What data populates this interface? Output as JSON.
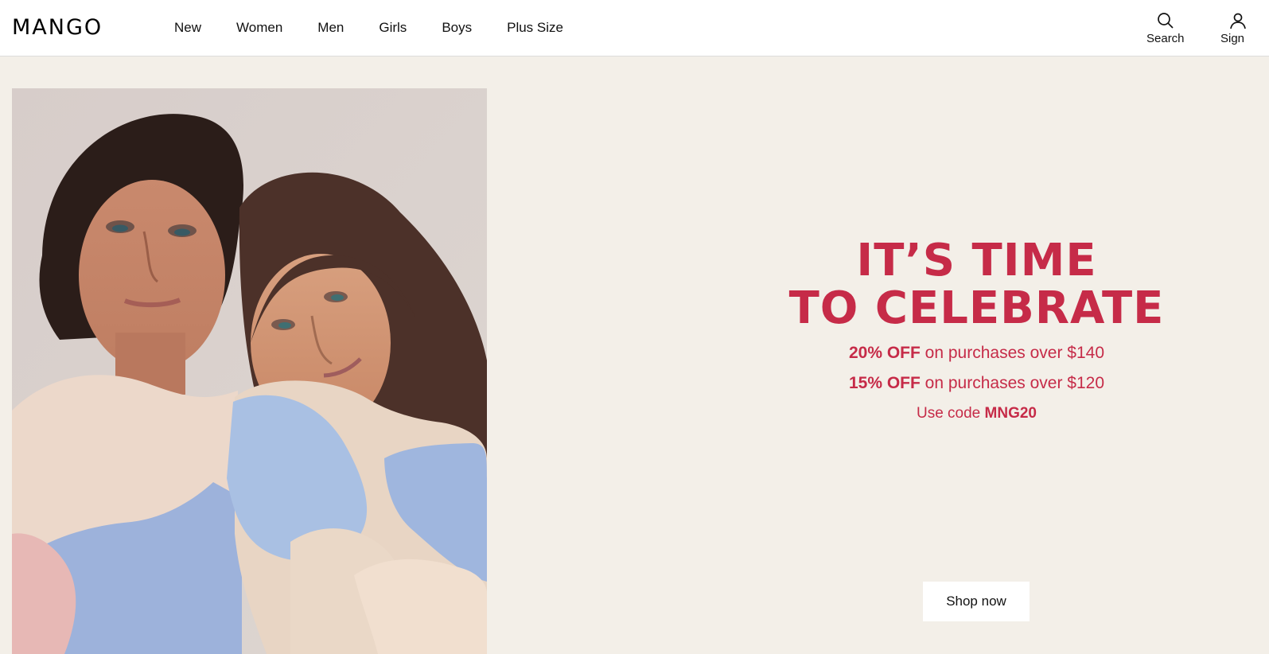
{
  "header": {
    "logo": "MANGO",
    "nav": [
      "New",
      "Women",
      "Men",
      "Girls",
      "Boys",
      "Plus Size"
    ],
    "utility": {
      "search_label": "Search",
      "signin_label": "Sign"
    }
  },
  "promo": {
    "title_line1": "IT’S TIME",
    "title_line2": "TO CELEBRATE",
    "offer1_bold": "20% OFF",
    "offer1_text": " on purchases over $140",
    "offer2_bold": "15% OFF",
    "offer2_text": " on purchases over $120",
    "code_prefix": "Use code ",
    "code": "MNG20",
    "cta": "Shop now"
  },
  "colors": {
    "background": "#f3efe8",
    "accent": "#c62b48",
    "header": "#ffffff",
    "text": "#111111"
  },
  "icons": {
    "search": "search-icon",
    "user": "user-icon"
  }
}
